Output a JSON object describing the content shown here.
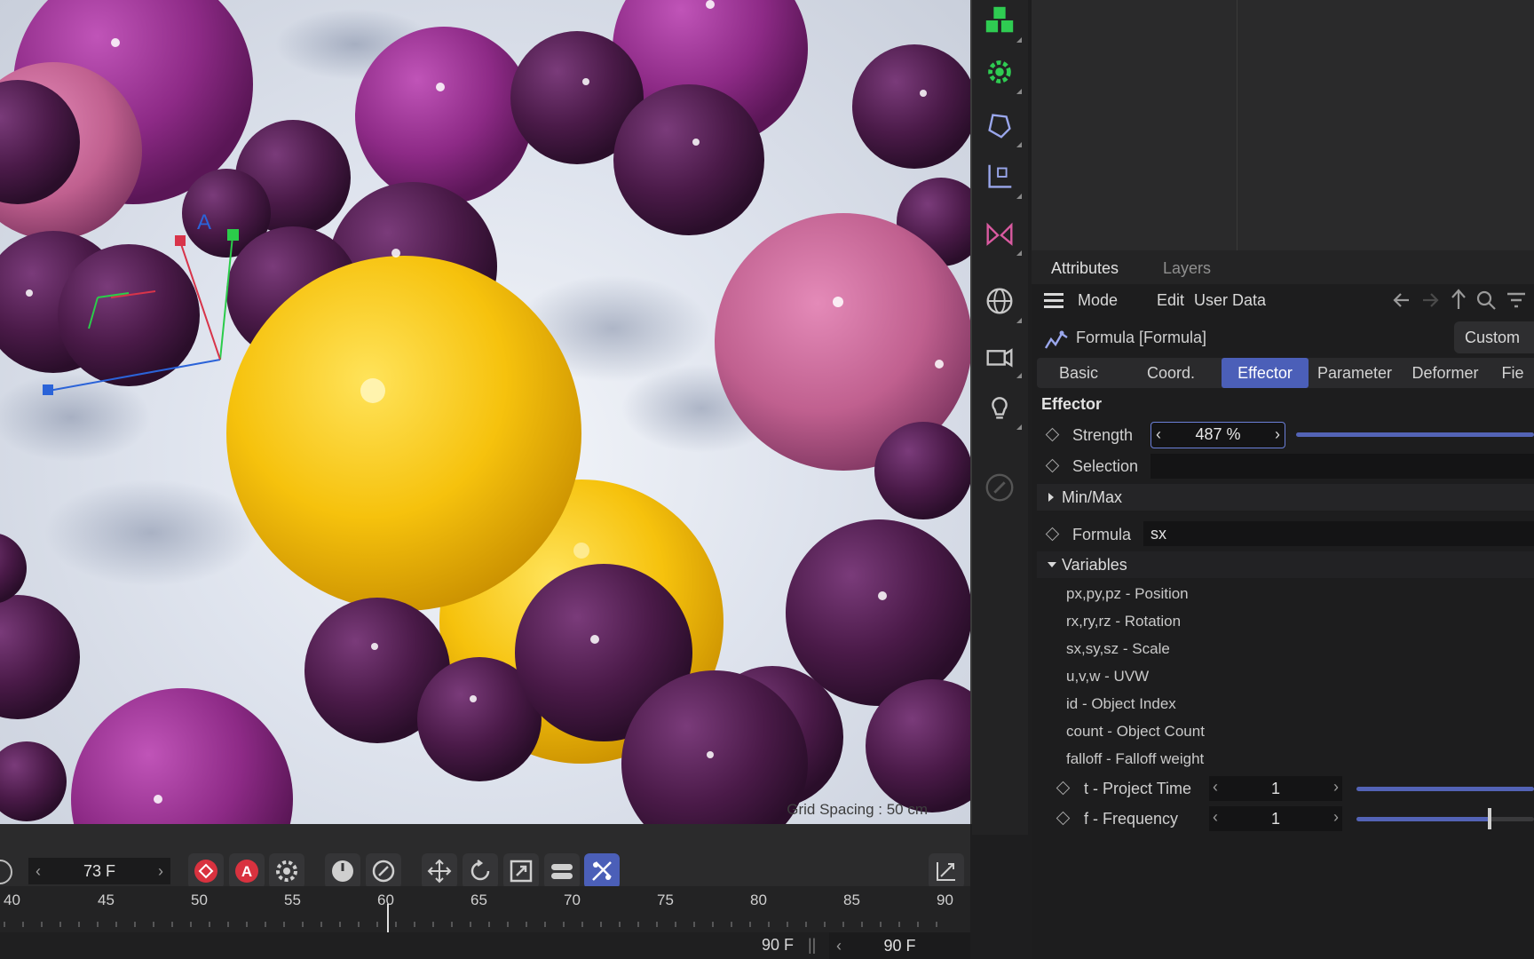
{
  "viewport": {
    "grid_spacing": "Grid Spacing : 50 cm",
    "axis_label": "A"
  },
  "tools": [
    {
      "name": "cloner-icon"
    },
    {
      "name": "effector-gear-icon"
    },
    {
      "name": "deformer-icon"
    },
    {
      "name": "coordinate-icon"
    },
    {
      "name": "symmetry-icon"
    },
    {
      "name": "environment-icon"
    },
    {
      "name": "camera-icon"
    },
    {
      "name": "light-icon"
    },
    {
      "name": "edit-icon"
    }
  ],
  "attributes": {
    "tabs": [
      "Attributes",
      "Layers"
    ],
    "menu": [
      "Mode",
      "Edit",
      "User Data"
    ],
    "object_name": "Formula [Formula]",
    "custom_button": "Custom",
    "subtabs": [
      "Basic",
      "Coord.",
      "Effector",
      "Parameter",
      "Deformer",
      "Fie"
    ],
    "active_subtab": "Effector",
    "section": "Effector",
    "strength": {
      "label": "Strength",
      "value": "487 %",
      "fill": 1.0
    },
    "selection": {
      "label": "Selection",
      "value": ""
    },
    "minmax": "Min/Max",
    "formula": {
      "label": "Formula",
      "value": "sx"
    },
    "variables_title": "Variables",
    "variables": [
      "px,py,pz - Position",
      "rx,ry,rz - Rotation",
      "sx,sy,sz - Scale",
      "u,v,w - UVW",
      "id - Object Index",
      "count - Object Count",
      "falloff - Falloff weight"
    ],
    "t_project_time": {
      "label": "t - Project Time",
      "value": "1",
      "fill": 1.0
    },
    "f_frequency": {
      "label": "f - Frequency",
      "value": "1",
      "fill": 0.75
    }
  },
  "timeline": {
    "current_frame": "73 F",
    "ticks": [
      "40",
      "45",
      "50",
      "55",
      "60",
      "65",
      "70",
      "75",
      "80",
      "85",
      "90"
    ],
    "end_frame_label": "90 F",
    "end_frame_field": "90 F",
    "accent": "#4b5fb8"
  }
}
